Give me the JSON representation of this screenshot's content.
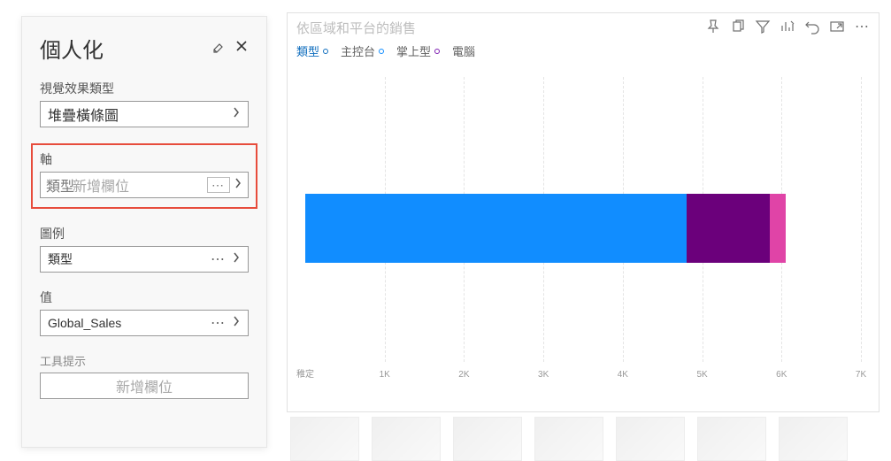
{
  "panel": {
    "title": "個人化",
    "visual_type": {
      "label": "視覺效果類型",
      "value": "堆疊橫條圖"
    },
    "axis": {
      "label": "軸",
      "chip": "類型",
      "placeholder": "新增欄位"
    },
    "legend": {
      "label": "圖例",
      "value": "類型"
    },
    "values": {
      "label": "值",
      "value": "Global_Sales"
    },
    "tooltip": {
      "label": "工具提示",
      "placeholder": "新增欄位"
    }
  },
  "visual": {
    "title": "依區域和平台的銷售",
    "legend_items": [
      {
        "label": "類型",
        "color": "#106ebe",
        "active": true
      },
      {
        "label": "主控台",
        "color": "#106ebe"
      },
      {
        "label": "掌上型",
        "color": "#7d1db1"
      },
      {
        "label": "電腦",
        "color": "#e755b5"
      }
    ],
    "y_axis_label": "稚定",
    "ticks": [
      "1K",
      "2K",
      "3K",
      "4K",
      "5K",
      "6K",
      "7K"
    ]
  },
  "chart_data": {
    "type": "bar",
    "orientation": "horizontal",
    "categories": [
      "稚定"
    ],
    "series": [
      {
        "name": "主控台",
        "values": [
          4800
        ],
        "color": "#118dff"
      },
      {
        "name": "掌上型",
        "values": [
          1050
        ],
        "color": "#6b007b"
      },
      {
        "name": "電腦",
        "values": [
          200
        ],
        "color": "#e044a7"
      }
    ],
    "title": "依區域和平台的銷售",
    "xlabel": "",
    "ylabel": "",
    "xlim": [
      0,
      7000
    ],
    "x_ticks": [
      1000,
      2000,
      3000,
      4000,
      5000,
      6000,
      7000
    ]
  }
}
